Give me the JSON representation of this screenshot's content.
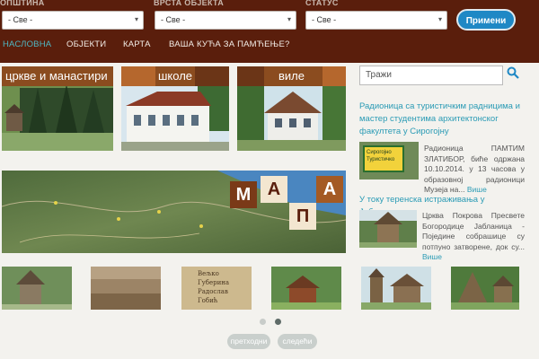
{
  "header": {
    "filters": [
      {
        "label": "ОПШТИНА",
        "value": "- Све -"
      },
      {
        "label": "ВРСТА ОБЈЕКТА",
        "value": "- Све -"
      },
      {
        "label": "СТАТУС",
        "value": "- Све -"
      }
    ],
    "apply_label": "Примени"
  },
  "nav": {
    "items": [
      {
        "label": "НАСЛОВНА"
      },
      {
        "label": "ОБЈЕКТИ"
      },
      {
        "label": "КАРТА"
      },
      {
        "label": "ВАША КУЋА ЗА ПАМЋЕЊЕ?"
      }
    ]
  },
  "categories": [
    {
      "label": "цркве и манастири"
    },
    {
      "label": "школе"
    },
    {
      "label": "виле"
    }
  ],
  "map": {
    "letters": [
      "М",
      "А",
      "П",
      "А"
    ]
  },
  "thumb_dots": [
    "Вељко",
    "Губерина",
    "Радослав",
    "Гобић"
  ],
  "carousel": {
    "prev_label": "претходни",
    "next_label": "следећи"
  },
  "sidebar": {
    "search_placeholder": "Тражи",
    "news": [
      {
        "title": "Радионица са туристичким радницима и мастер студентима архитектонског факултета у Сирогојну",
        "text": "Радионица ПАМТИМ ЗЛАТИБОР, биће одржана 10.10.2014. у 13 часова у образовној радионици Музеја на...",
        "more": "Више",
        "sign_lines": [
          "Сирогојно",
          "Туристичко"
        ]
      },
      {
        "title": "У току теренска истраживања у Јабланици",
        "text": "Црква Покрова Пресвете Богородице Јабланица - Поједине собрашице су потпуно затворене, док су...",
        "more": "Више"
      }
    ]
  },
  "colors": {
    "header_bg": "#5a1e0c",
    "accent": "#1f88c5",
    "link": "#2a9bb5",
    "tile_brown": "#8b4c1f"
  }
}
